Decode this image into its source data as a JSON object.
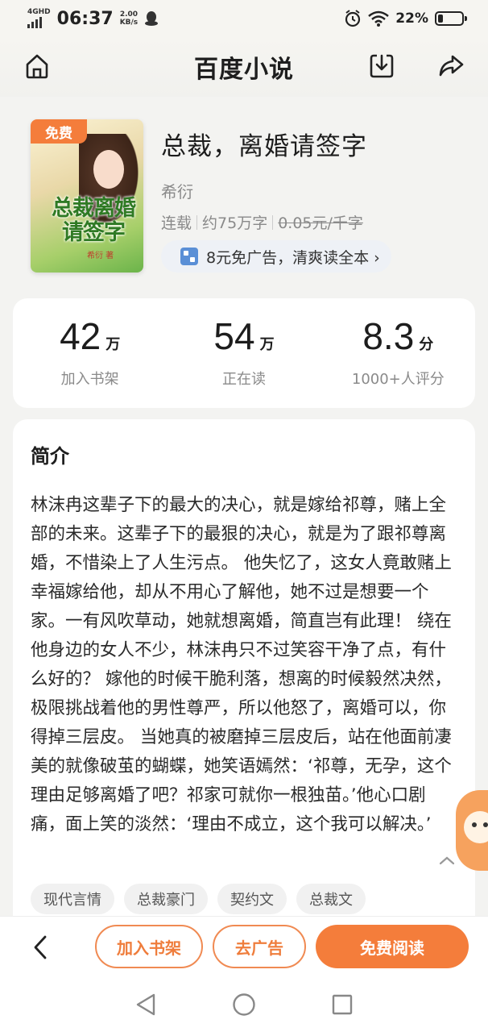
{
  "status_bar": {
    "network": "4GHD",
    "time": "06:37",
    "speed_value": "2.00",
    "speed_unit": "KB/s",
    "battery_percent": "22%",
    "battery_level": 0.22,
    "icons": [
      "signal-icon",
      "qq-icon",
      "alarm-icon",
      "wifi-icon",
      "battery-icon"
    ]
  },
  "header": {
    "title": "百度小说",
    "icons": [
      "home-icon",
      "download-icon",
      "share-icon"
    ]
  },
  "book": {
    "cover_badge": "免费",
    "cover_title": "总裁离婚请签字",
    "cover_author": "希衍 著",
    "title": "总裁，离婚请签字",
    "author": "希衍",
    "status": "连载",
    "word_count": "约75万字",
    "price": "0.05元/千字",
    "ad_free_text": "8元免广告，清爽读全本 ›"
  },
  "stats": [
    {
      "value": "42",
      "unit": "万",
      "label": "加入书架"
    },
    {
      "value": "54",
      "unit": "万",
      "label": "正在读"
    },
    {
      "value": "8.3",
      "unit": "分",
      "label": "1000+人评分"
    }
  ],
  "intro": {
    "heading": "简介",
    "text": "林沫冉这辈子下的最大的决心，就是嫁给祁尊，赌上全部的未来。这辈子下的最狠的决心，就是为了跟祁尊离婚，不惜染上了人生污点。 他失忆了，这女人竟敢赌上幸福嫁给他，却从不用心了解他，她不过是想要一个家。一有风吹草动，她就想离婚，简直岂有此理！ 绕在他身边的女人不少，林沫冉只不过笑容干净了点，有什么好的？ 嫁他的时候干脆利落，想离的时候毅然决然，极限挑战着他的男性尊严，所以他怒了，离婚可以，你得掉三层皮。 当她真的被磨掉三层皮后，站在他面前凄美的就像破茧的蝴蝶，她笑语嫣然：‘祁尊，无孕，这个理由足够离婚了吧？祁家可就你一根独苗。’他心口剧痛，面上笑的淡然：‘理由不成立，这个我可以解决。’",
    "tags": [
      "现代言情",
      "总裁豪门",
      "契约文",
      "总裁文"
    ]
  },
  "actions": {
    "add_shelf": "加入书架",
    "remove_ads": "去广告",
    "free_read": "免费阅读"
  },
  "colors": {
    "accent": "#f47d3b",
    "background": "#f3f3f1",
    "card": "#ffffff",
    "muted_text": "#8a8a8a"
  }
}
